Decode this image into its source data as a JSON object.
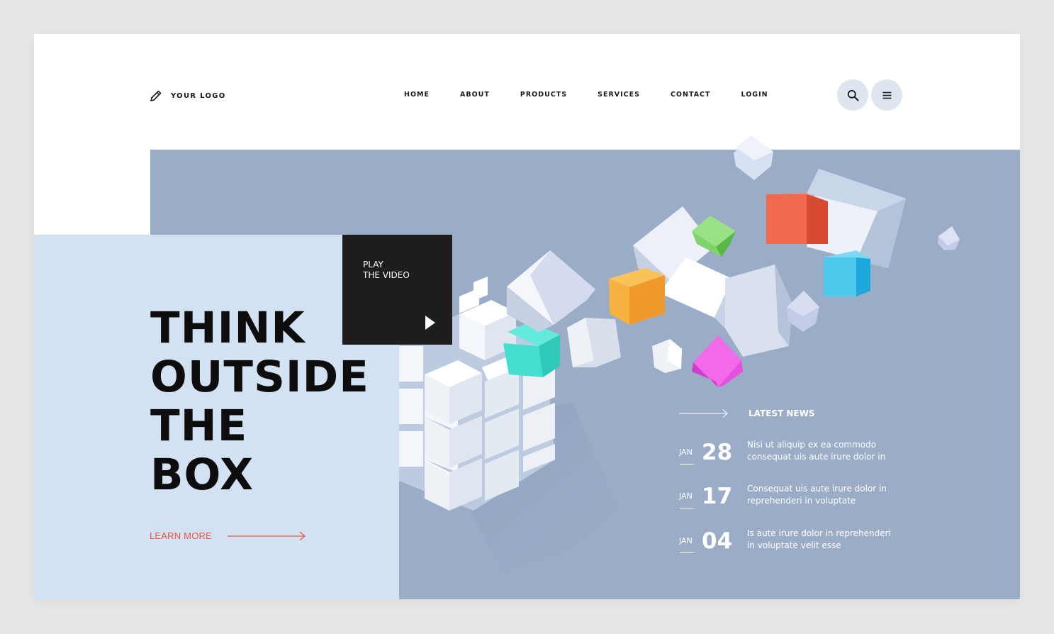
{
  "header": {
    "logo_text": "YOUR LOGO",
    "logo_icon": "pencil-icon",
    "nav": [
      "HOME",
      "ABOUT",
      "PRODUCTS",
      "SERVICES",
      "CONTACT",
      "LOGIN"
    ],
    "search_icon": "search-icon",
    "menu_icon": "menu-icon"
  },
  "hero": {
    "headline": [
      "THINK",
      "OUTSIDE",
      "THE",
      "BOX"
    ],
    "cta_label": "LEARN MORE",
    "video": {
      "line1": "PLAY",
      "line2": "THE VIDEO",
      "icon": "play-icon"
    }
  },
  "news": {
    "title": "LATEST NEWS",
    "items": [
      {
        "month": "JAN",
        "day": "28",
        "text": "Nisi ut aliquip ex ea commodo consequat uis aute irure dolor in"
      },
      {
        "month": "JAN",
        "day": "17",
        "text": "Consequat uis aute irure dolor in reprehenderi in voluptate"
      },
      {
        "month": "JAN",
        "day": "04",
        "text": "Is aute irure dolor in reprehenderi in voluptate velit esse"
      }
    ]
  },
  "colors": {
    "background": "#e7e7e7",
    "hero_blue": "#9bacc7",
    "hero_light": "#d3e2f2",
    "accent": "#e8553d",
    "video_box": "#1e1c1d",
    "cube_red": "#f06a4f",
    "cube_orange": "#f6b240",
    "cube_green": "#7ed46a",
    "cube_teal": "#44e0cf",
    "cube_blue": "#4fc9ee",
    "cube_magenta": "#e84fe0"
  }
}
